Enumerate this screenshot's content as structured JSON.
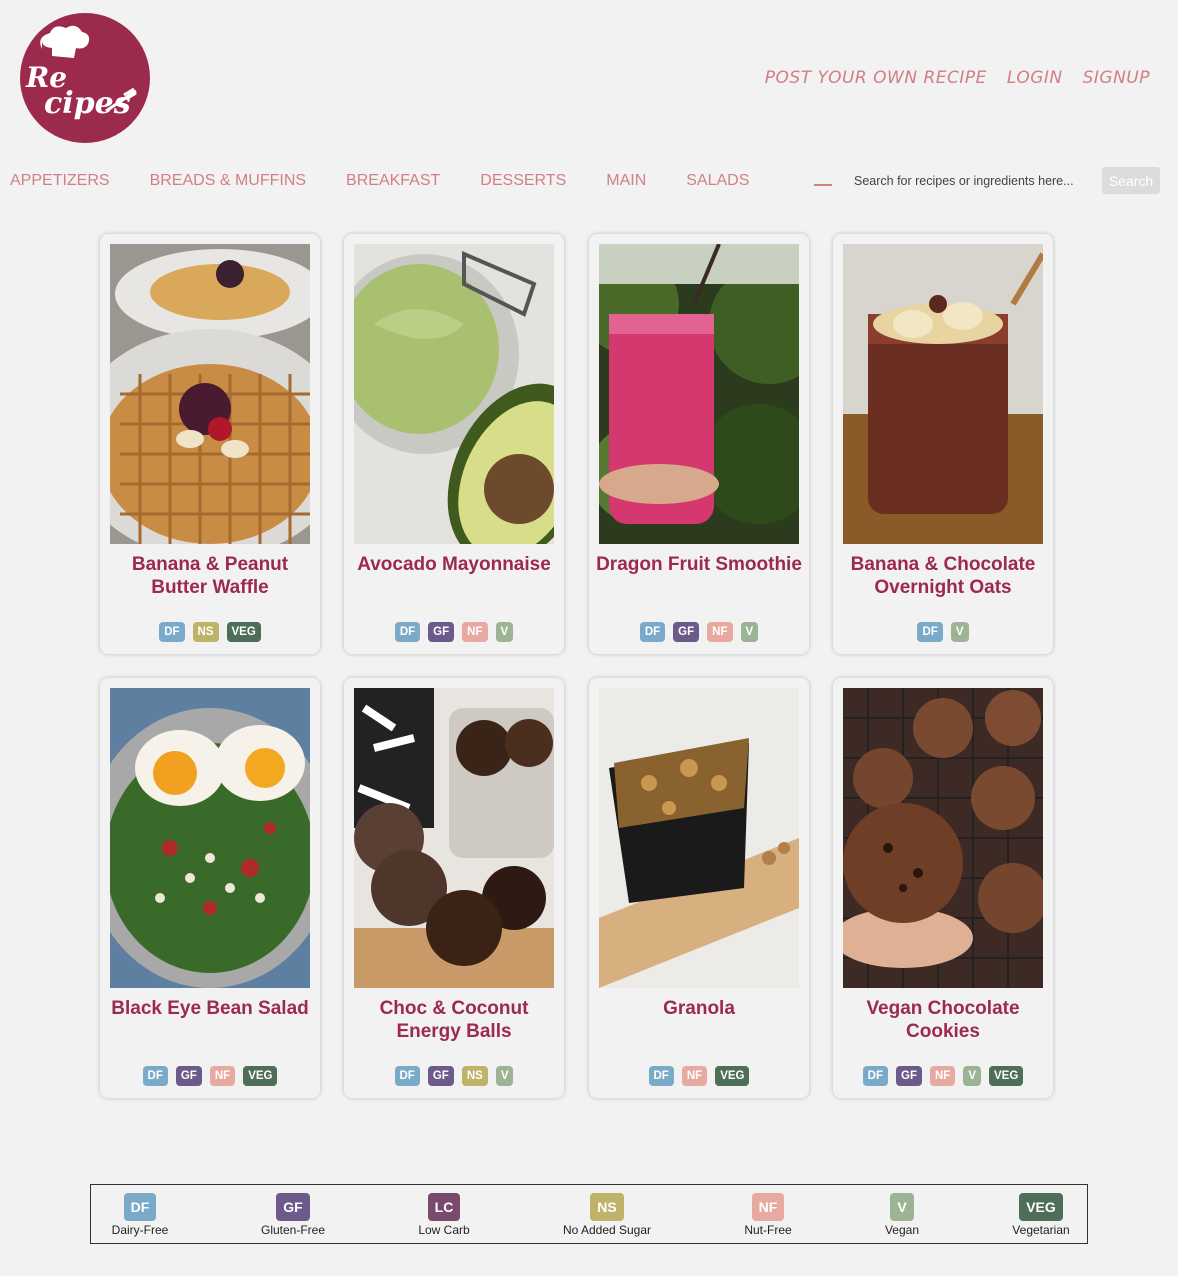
{
  "logo": {
    "text_top": "Re",
    "text_bottom": "cipes"
  },
  "top_links": [
    "POST YOUR OWN RECIPE",
    "LOGIN",
    "SIGNUP"
  ],
  "categories": [
    "APPETIZERS",
    "BREADS & MUFFINS",
    "BREAKFAST",
    "DESSERTS",
    "MAIN",
    "SALADS"
  ],
  "search": {
    "placeholder": "Search for recipes or ingredients here...",
    "button": "Search"
  },
  "recipes": [
    {
      "title": "Banana & Peanut Butter Waffle",
      "tags": [
        "DF",
        "NS",
        "VEG"
      ],
      "photo": "waffle"
    },
    {
      "title": "Avocado Mayonnaise",
      "tags": [
        "DF",
        "GF",
        "NF",
        "V"
      ],
      "photo": "avocado"
    },
    {
      "title": "Dragon Fruit Smoothie",
      "tags": [
        "DF",
        "GF",
        "NF",
        "V"
      ],
      "photo": "smoothie"
    },
    {
      "title": "Banana & Chocolate Overnight Oats",
      "tags": [
        "DF",
        "V"
      ],
      "photo": "oats"
    },
    {
      "title": "Black Eye Bean Salad",
      "tags": [
        "DF",
        "GF",
        "NF",
        "VEG"
      ],
      "photo": "salad"
    },
    {
      "title": "Choc & Coconut Energy Balls",
      "tags": [
        "DF",
        "GF",
        "NS",
        "V"
      ],
      "photo": "balls"
    },
    {
      "title": "Granola",
      "tags": [
        "DF",
        "NF",
        "VEG"
      ],
      "photo": "granola"
    },
    {
      "title": "Vegan Chocolate Cookies",
      "tags": [
        "DF",
        "GF",
        "NF",
        "V",
        "VEG"
      ],
      "photo": "cookies"
    }
  ],
  "legend": [
    {
      "code": "DF",
      "label": "Dairy-Free"
    },
    {
      "code": "GF",
      "label": "Gluten-Free"
    },
    {
      "code": "LC",
      "label": "Low Carb"
    },
    {
      "code": "NS",
      "label": "No Added Sugar"
    },
    {
      "code": "NF",
      "label": "Nut-Free"
    },
    {
      "code": "V",
      "label": "Vegan"
    },
    {
      "code": "VEG",
      "label": "Vegetarian"
    }
  ],
  "colors": {
    "brand": "#9c2a4c",
    "nav": "#d17f86",
    "DF": "#7aaac8",
    "GF": "#6c5b8a",
    "LC": "#7a4a6e",
    "NS": "#bfb36a",
    "NF": "#e8aaa0",
    "V": "#9cb493",
    "VEG": "#4e6e58"
  }
}
